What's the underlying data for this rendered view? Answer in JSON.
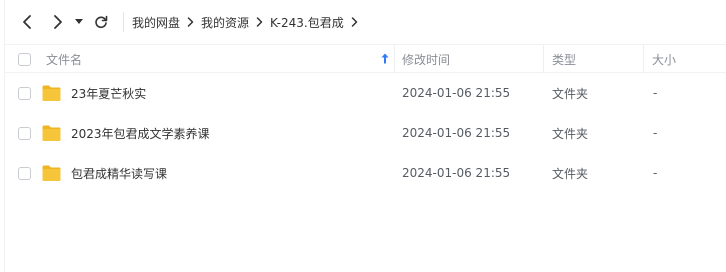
{
  "nav": {
    "back_icon": "chevron-left-icon",
    "forward_icon": "chevron-right-icon",
    "history_icon": "caret-down-icon",
    "refresh_icon": "refresh-icon"
  },
  "breadcrumb": [
    "我的网盘",
    "我的资源",
    "K-243.包君成"
  ],
  "header": {
    "name": "文件名",
    "modified": "修改时间",
    "type": "类型",
    "size": "大小"
  },
  "files": [
    {
      "name": "23年夏芒秋实",
      "modified": "2024-01-06 21:55",
      "type": "文件夹",
      "size": "-"
    },
    {
      "name": "2023年包君成文学素养课",
      "modified": "2024-01-06 21:55",
      "type": "文件夹",
      "size": "-"
    },
    {
      "name": "包君成精华读写课",
      "modified": "2024-01-06 21:55",
      "type": "文件夹",
      "size": "-"
    }
  ],
  "colors": {
    "folder": "#f7c53a",
    "sort_arrow": "#2f7bf6"
  }
}
